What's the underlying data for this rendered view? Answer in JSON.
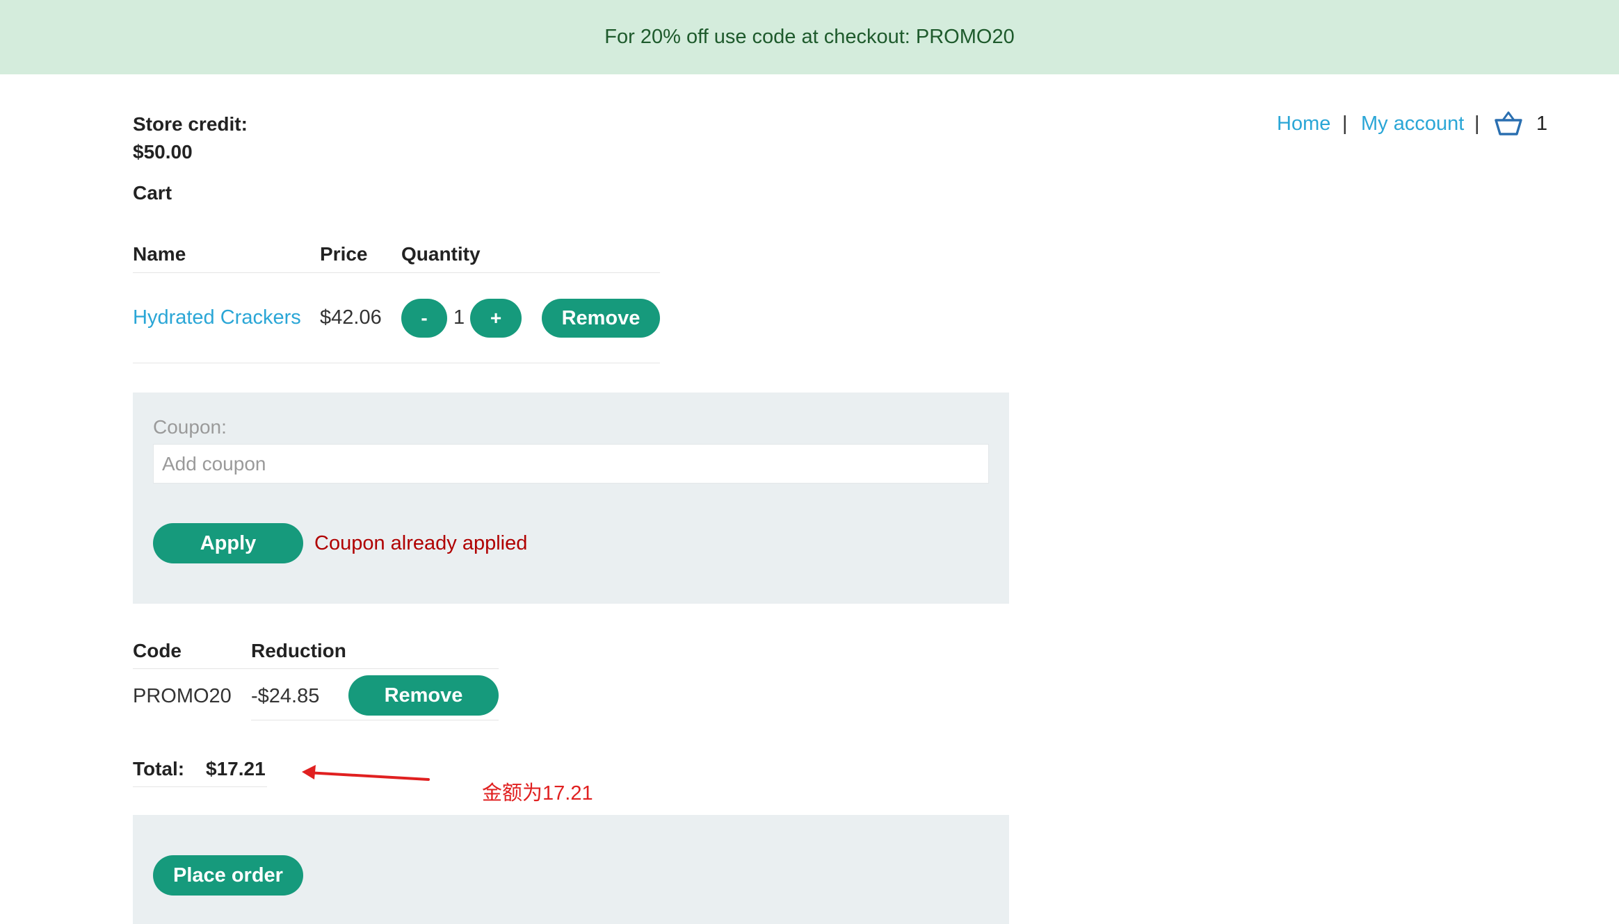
{
  "banner": {
    "text": "For 20% off use code at checkout: PROMO20"
  },
  "nav": {
    "home": "Home",
    "separator": "|",
    "account": "My account",
    "cart_count": "1"
  },
  "store_credit": {
    "label": "Store credit:",
    "value": "$50.00"
  },
  "cart": {
    "heading": "Cart",
    "columns": [
      "Name",
      "Price",
      "Quantity"
    ],
    "items": [
      {
        "name": "Hydrated Crackers",
        "price": "$42.06",
        "minus": "-",
        "qty": "1",
        "plus": "+",
        "remove": "Remove"
      }
    ]
  },
  "coupon": {
    "label": "Coupon:",
    "placeholder": "Add coupon",
    "apply": "Apply",
    "message": "Coupon already applied"
  },
  "applied_coupons": {
    "columns": [
      "Code",
      "Reduction"
    ],
    "rows": [
      {
        "code": "PROMO20",
        "reduction": "-$24.85",
        "remove": "Remove"
      }
    ]
  },
  "total": {
    "label": "Total:",
    "value": "$17.21"
  },
  "annotation": {
    "text": "金额为17.21"
  },
  "checkout": {
    "place_order": "Place order"
  },
  "colors": {
    "banner_bg": "#d4ecdc",
    "accent": "#169a7c",
    "link": "#2aa6d6",
    "error": "#b00000",
    "annotation": "#e02020"
  }
}
